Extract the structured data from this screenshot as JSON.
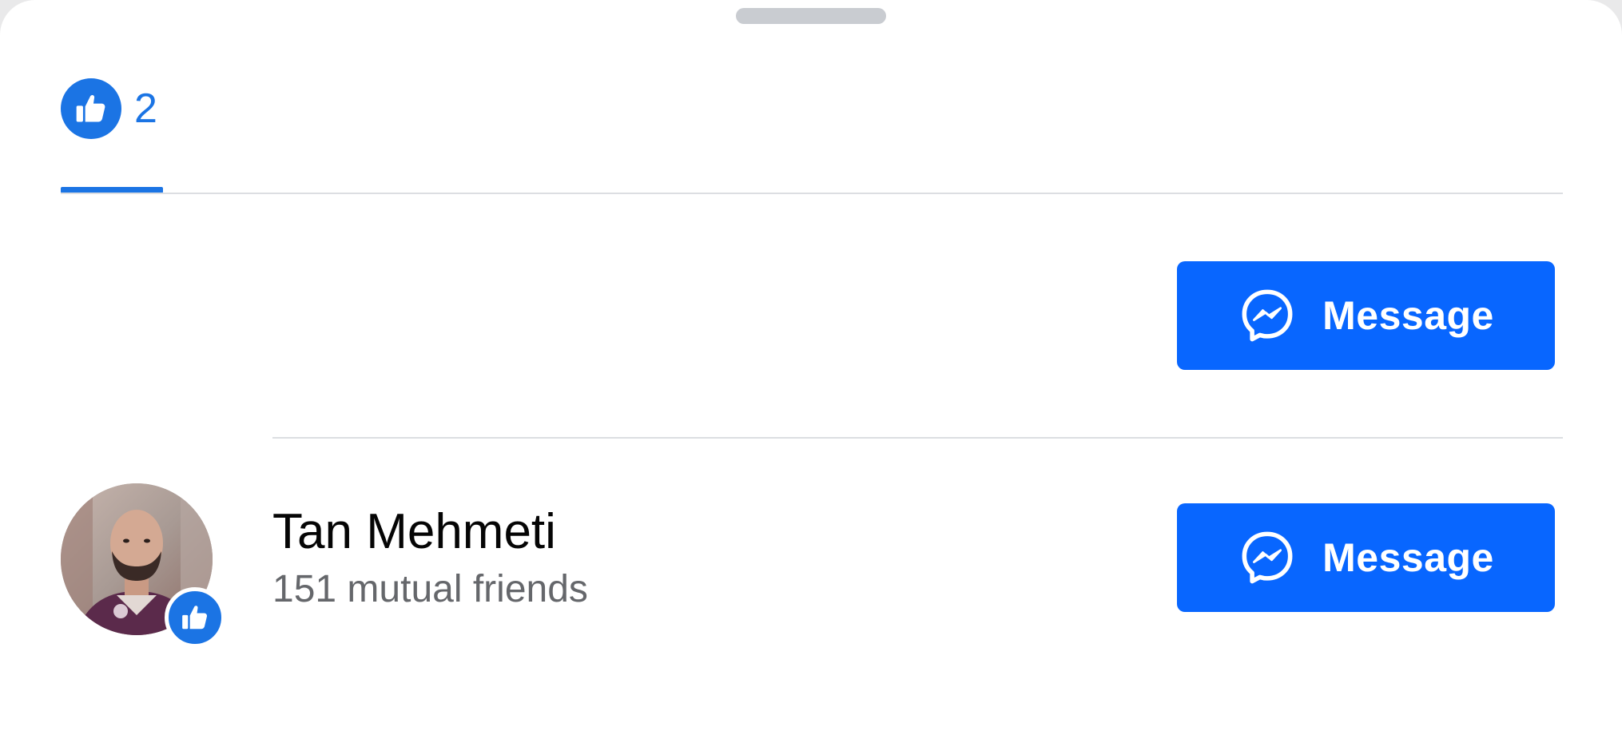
{
  "sheet": {
    "grabber_name": "sheet-grabber"
  },
  "reactions_tab": {
    "icon": "thumbs-up-icon",
    "count": "2"
  },
  "people": [
    {
      "name": "",
      "mutual_friends": "",
      "reaction_icon": "thumbs-up-icon",
      "button_icon": "messenger-icon",
      "button_label": "Message"
    },
    {
      "name": "Tan Mehmeti",
      "mutual_friends": "151 mutual friends",
      "reaction_icon": "thumbs-up-icon",
      "button_icon": "messenger-icon",
      "button_label": "Message"
    }
  ],
  "colors": {
    "accent": "#1b74e4",
    "button": "#0866ff",
    "text_primary": "#050505",
    "text_secondary": "#65676b"
  }
}
